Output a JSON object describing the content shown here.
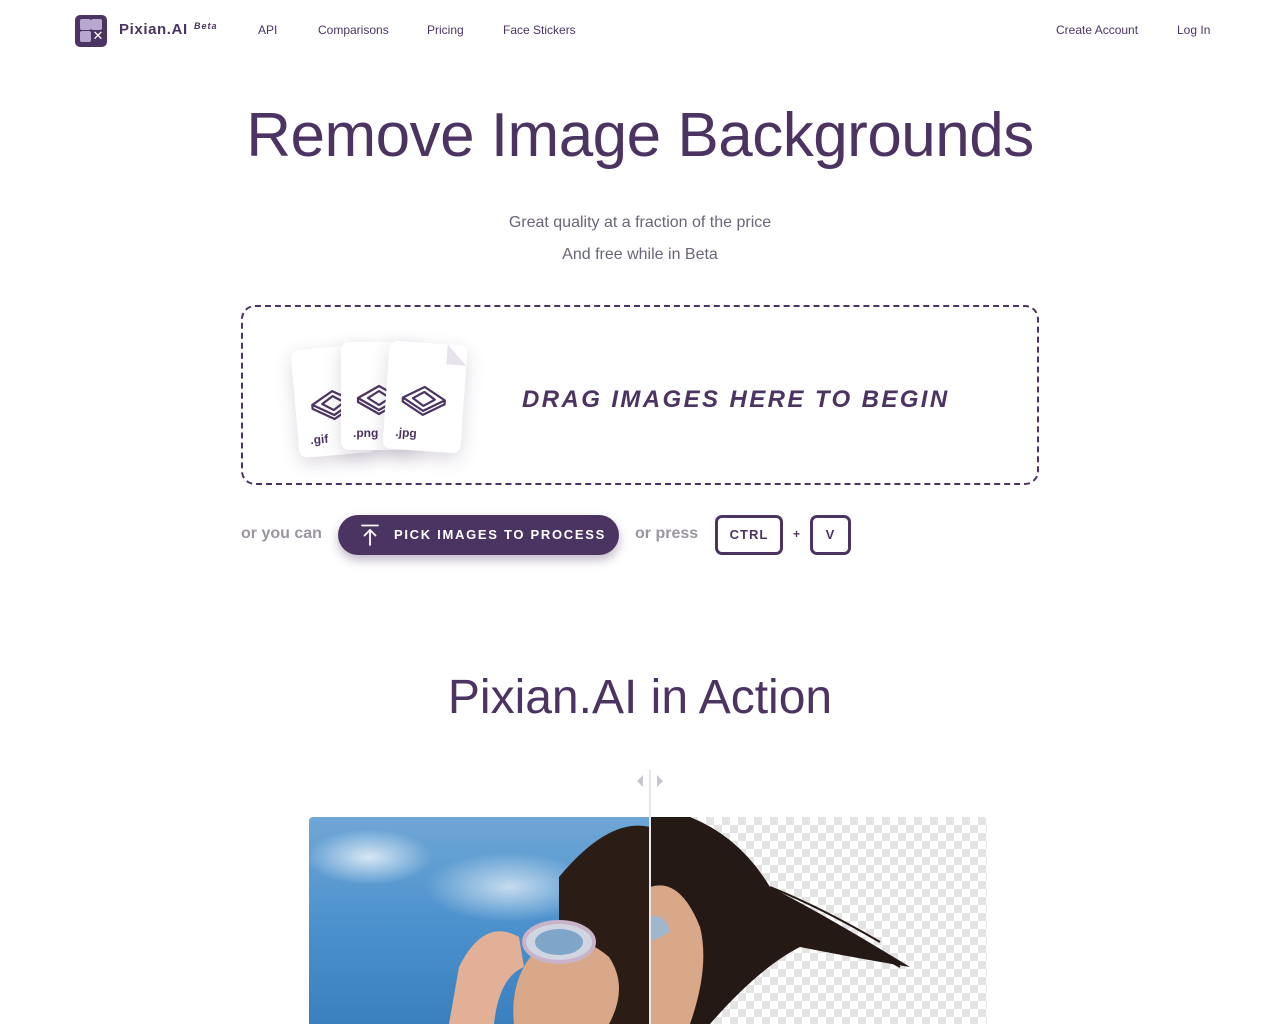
{
  "header": {
    "brand": "Pixian.AI",
    "beta_badge": "Beta",
    "nav": [
      "API",
      "Comparisons",
      "Pricing",
      "Face Stickers"
    ],
    "create_account": "Create Account",
    "log_in": "Log In"
  },
  "hero": {
    "title": "Remove Image Backgrounds",
    "subtitle_1": "Great quality at a fraction of the price",
    "subtitle_2": "And free while in Beta"
  },
  "dropzone": {
    "file_types": [
      ".gif",
      ".png",
      ".jpg"
    ],
    "prompt": "DRAG IMAGES HERE TO BEGIN"
  },
  "actions": {
    "or_you_can": "or you can",
    "pick_button": "PICK IMAGES TO PROCESS",
    "or_press": "or press",
    "key_ctrl": "CTRL",
    "plus": "+",
    "key_v": "V"
  },
  "showcase": {
    "title": "Pixian.AI in Action"
  },
  "colors": {
    "brand": "#4b3462",
    "muted_text": "#9a95a1"
  },
  "icons": [
    "logo-icon",
    "image-file-icon",
    "upload-arrow-icon",
    "slider-handle-icon"
  ]
}
